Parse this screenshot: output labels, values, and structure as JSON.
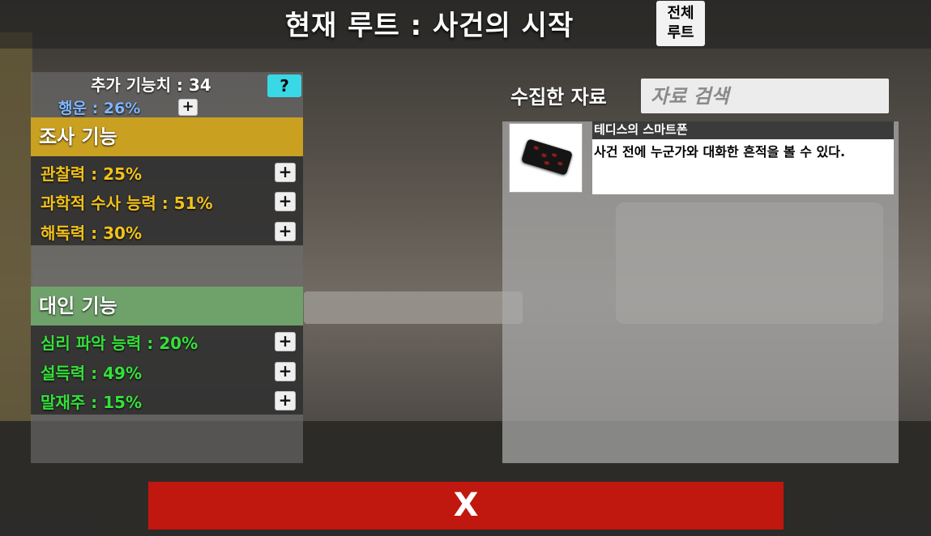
{
  "header": {
    "title": "현재 루트 : 사건의 시작",
    "all_route_button": "전체\n루트"
  },
  "stats": {
    "extra_points": "추가 기능치 : 34",
    "help_label": "?",
    "luck": "행운 : 26%",
    "plus_label": "+"
  },
  "investigation": {
    "header": "조사 기능",
    "header_color": "#c9a020",
    "text_color": "#f2c21a",
    "skills": [
      {
        "label": "관찰력 : 25%"
      },
      {
        "label": "과학적 수사 능력 : 51%"
      },
      {
        "label": "해독력 : 30%"
      }
    ]
  },
  "interpersonal": {
    "header": "대인 기능",
    "header_color": "#6fa26a",
    "text_color": "#35e03a",
    "skills": [
      {
        "label": "심리 파악 능력 : 20%"
      },
      {
        "label": "설득력 : 49%"
      },
      {
        "label": "말재주 : 15%"
      }
    ]
  },
  "collected": {
    "label": "수집한 자료",
    "search_placeholder": "자료 검색",
    "items": [
      {
        "name": "테디스의 스마트폰",
        "description": "사건 전에 누군가와 대화한 흔적을 볼 수 있다.",
        "icon": "smartphone-icon"
      }
    ]
  },
  "close_button": "X"
}
